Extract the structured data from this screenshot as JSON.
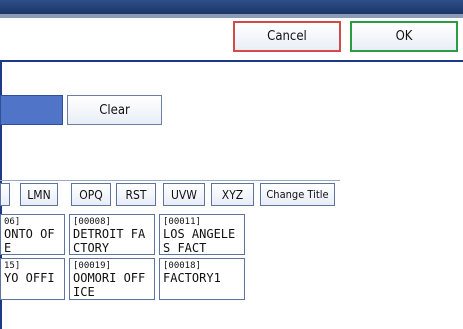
{
  "header": {
    "cancel_label": "Cancel",
    "ok_label": "OK"
  },
  "search": {
    "clear_label": "Clear"
  },
  "tabs": {
    "labels": [
      "LMN",
      "OPQ",
      "RST",
      "UVW",
      "XYZ"
    ],
    "change_title_label": "Change Title"
  },
  "entries": {
    "row1": [
      {
        "code": "06]",
        "name": "ONTO OF\nE"
      },
      {
        "code": "[00008]",
        "name": "DETROIT FA\nCTORY"
      },
      {
        "code": "[00011]",
        "name": "LOS ANGELE\nS FACT"
      }
    ],
    "row2": [
      {
        "code": "15]",
        "name": "YO OFFI"
      },
      {
        "code": "[00019]",
        "name": "OOMORI OFF\nICE"
      },
      {
        "code": "[00018]",
        "name": "FACTORY1"
      }
    ]
  }
}
